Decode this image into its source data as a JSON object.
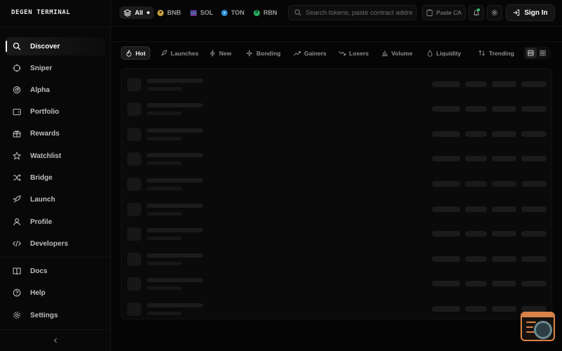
{
  "app": {
    "logo": "DEGEN TERMINAL"
  },
  "sidebar": {
    "items": [
      {
        "label": "Discover",
        "icon": "search-icon",
        "active": true
      },
      {
        "label": "Sniper",
        "icon": "crosshair-icon"
      },
      {
        "label": "Alpha",
        "icon": "radar-icon"
      },
      {
        "label": "Portfolio",
        "icon": "wallet-icon"
      },
      {
        "label": "Rewards",
        "icon": "gift-icon"
      },
      {
        "label": "Watchlist",
        "icon": "star-icon"
      },
      {
        "label": "Bridge",
        "icon": "shuffle-icon"
      },
      {
        "label": "Launch",
        "icon": "rocket-icon"
      },
      {
        "label": "Profile",
        "icon": "user-icon"
      },
      {
        "label": "Developers",
        "icon": "code-icon"
      }
    ],
    "footer_items": [
      {
        "label": "Docs",
        "icon": "book-icon"
      },
      {
        "label": "Help",
        "icon": "help-circle-icon"
      },
      {
        "label": "Settings",
        "icon": "gear-icon"
      }
    ],
    "collapse_icon": "chevron-left-icon"
  },
  "topbar": {
    "chains": [
      {
        "label": "All",
        "icon": "layers-icon",
        "active": true
      },
      {
        "label": "BNB",
        "icon": "bnb-icon",
        "color": "#c9a23c"
      },
      {
        "label": "SOL",
        "icon": "sol-icon",
        "color": "#8b5cf6"
      },
      {
        "label": "TON",
        "icon": "ton-icon",
        "color": "#2f8fd6"
      },
      {
        "label": "RBN",
        "icon": "rbn-icon",
        "color": "#27ae60"
      }
    ],
    "search": {
      "placeholder": "Search tokens, paste contract address"
    },
    "paste_label": "Paste CA",
    "signin_label": "Sign In"
  },
  "filters": {
    "tabs": [
      {
        "label": "Hot",
        "icon": "flame-icon",
        "active": true
      },
      {
        "label": "Launches",
        "icon": "rocket-icon"
      },
      {
        "label": "New",
        "icon": "zap-icon"
      },
      {
        "label": "Bonding",
        "icon": "sparkle-icon"
      },
      {
        "label": "Gainers",
        "icon": "trending-up-icon"
      },
      {
        "label": "Losers",
        "icon": "trending-down-icon"
      },
      {
        "label": "Volume",
        "icon": "bar-chart-icon"
      },
      {
        "label": "Liquidity",
        "icon": "droplet-icon"
      },
      {
        "label": "Trending",
        "icon": "sort-icon"
      }
    ],
    "view_modes": [
      "list-view-icon",
      "grid-view-icon"
    ]
  },
  "colors": {
    "background": "#050505",
    "accent": "#ffffff",
    "widget": "#d9824a"
  }
}
